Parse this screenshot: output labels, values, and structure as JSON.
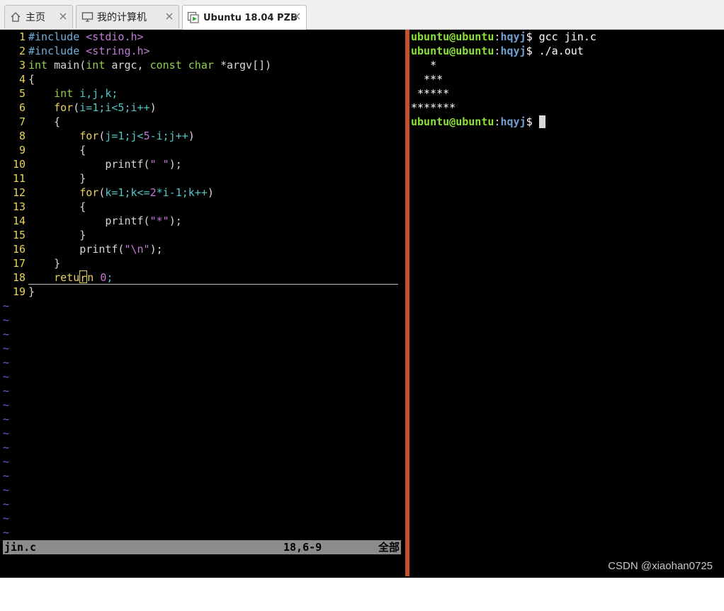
{
  "tabs": [
    {
      "label": "主页",
      "icon": "home-icon"
    },
    {
      "label": "我的计算机",
      "icon": "monitor-icon"
    },
    {
      "label": "Ubuntu 18.04 PZB",
      "icon": "vm-running-icon"
    }
  ],
  "editor": {
    "lines": [
      {
        "n": "1",
        "tokens": [
          [
            "pre",
            "#include "
          ],
          [
            "str",
            "<stdio.h>"
          ]
        ]
      },
      {
        "n": "2",
        "tokens": [
          [
            "pre",
            "#include "
          ],
          [
            "str",
            "<string.h>"
          ]
        ]
      },
      {
        "n": "3",
        "tokens": [
          [
            "type",
            "int "
          ],
          [
            "plain",
            "main("
          ],
          [
            "type",
            "int "
          ],
          [
            "plain",
            "argc, "
          ],
          [
            "type",
            "const char "
          ],
          [
            "plain",
            "*argv[])"
          ]
        ]
      },
      {
        "n": "4",
        "tokens": [
          [
            "plain",
            "{"
          ]
        ]
      },
      {
        "n": "5",
        "tokens": [
          [
            "plain",
            "    "
          ],
          [
            "type",
            "int "
          ],
          [
            "id",
            "i,j,k;"
          ]
        ]
      },
      {
        "n": "6",
        "tokens": [
          [
            "plain",
            "    "
          ],
          [
            "kw",
            "for"
          ],
          [
            "plain",
            "("
          ],
          [
            "id",
            "i=1;i<5;i++"
          ],
          [
            "plain",
            ")"
          ]
        ]
      },
      {
        "n": "7",
        "tokens": [
          [
            "plain",
            "    {"
          ]
        ]
      },
      {
        "n": "8",
        "tokens": [
          [
            "plain",
            "        "
          ],
          [
            "kw",
            "for"
          ],
          [
            "plain",
            "("
          ],
          [
            "id",
            "j=1;j<"
          ],
          [
            "num",
            "5"
          ],
          [
            "id",
            "-i;j++"
          ],
          [
            "plain",
            ")"
          ]
        ]
      },
      {
        "n": "9",
        "tokens": [
          [
            "plain",
            "        {"
          ]
        ]
      },
      {
        "n": "10",
        "tokens": [
          [
            "plain",
            "            printf("
          ],
          [
            "str",
            "\" \""
          ],
          [
            "plain",
            ");"
          ]
        ]
      },
      {
        "n": "11",
        "tokens": [
          [
            "plain",
            "        }"
          ]
        ]
      },
      {
        "n": "12",
        "tokens": [
          [
            "plain",
            "        "
          ],
          [
            "kw",
            "for"
          ],
          [
            "plain",
            "("
          ],
          [
            "id",
            "k=1;k<="
          ],
          [
            "num",
            "2"
          ],
          [
            "id",
            "*i-1;k++"
          ],
          [
            "plain",
            ")"
          ]
        ]
      },
      {
        "n": "13",
        "tokens": [
          [
            "plain",
            "        {"
          ]
        ]
      },
      {
        "n": "14",
        "tokens": [
          [
            "plain",
            "            printf("
          ],
          [
            "str",
            "\"*\""
          ],
          [
            "plain",
            ");"
          ]
        ]
      },
      {
        "n": "15",
        "tokens": [
          [
            "plain",
            "        }"
          ]
        ]
      },
      {
        "n": "16",
        "tokens": [
          [
            "plain",
            "        printf("
          ],
          [
            "str",
            "\"\\n\""
          ],
          [
            "plain",
            ");"
          ]
        ]
      },
      {
        "n": "17",
        "tokens": [
          [
            "plain",
            "    }"
          ]
        ]
      },
      {
        "n": "18",
        "tokens": [
          [
            "plain",
            "    "
          ],
          [
            "kw",
            "retu"
          ],
          [
            "cursor",
            "r"
          ],
          [
            "kw",
            "n "
          ],
          [
            "num",
            "0"
          ],
          [
            "id",
            ";"
          ]
        ],
        "current": true
      },
      {
        "n": "19",
        "tokens": [
          [
            "plain",
            "}"
          ]
        ]
      }
    ],
    "tilde_count": 17,
    "tilde_char": "~",
    "status": {
      "filename": "jin.c",
      "position": "18,6-9",
      "scroll": "全部"
    }
  },
  "terminal": {
    "lines": [
      {
        "user": "ubuntu@ubuntu",
        "path": "hqyj",
        "cmd": "$ gcc jin.c"
      },
      {
        "user": "ubuntu@ubuntu",
        "path": "hqyj",
        "cmd": "$ ./a.out"
      },
      {
        "text": "   *"
      },
      {
        "text": "  ***"
      },
      {
        "text": " *****"
      },
      {
        "text": "*******"
      },
      {
        "user": "ubuntu@ubuntu",
        "path": "hqyj",
        "cmd": "$ ",
        "cursor": true
      }
    ]
  },
  "watermark": "CSDN @xiaohan0725",
  "colors": {
    "divider": "#c0502e",
    "prompt_user": "#8ae234",
    "prompt_path": "#729fcf",
    "line_number": "#e8d35a"
  }
}
